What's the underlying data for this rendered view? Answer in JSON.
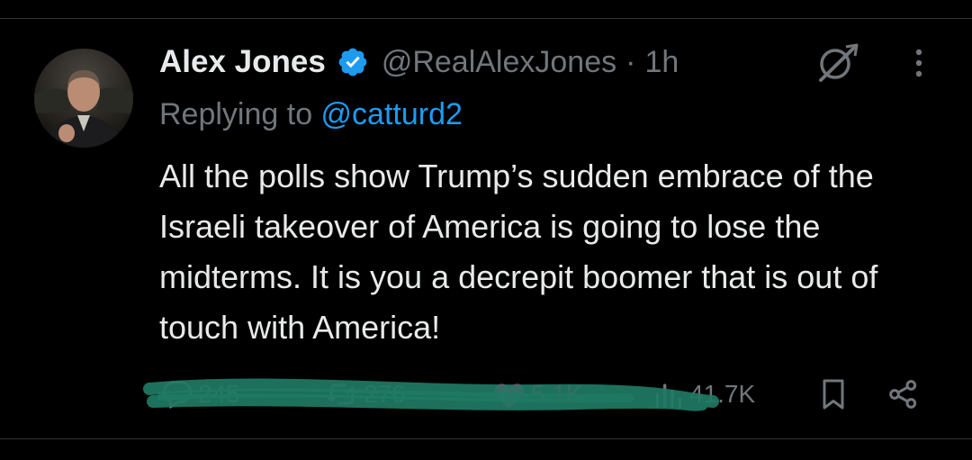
{
  "tweet": {
    "author": {
      "name": "Alex Jones",
      "handle": "@RealAlexJones",
      "verified_icon": "verified-badge-icon"
    },
    "separator": "·",
    "time": "1h",
    "replying_to_prefix": "Replying to ",
    "replying_to_handle": "@catturd2",
    "text": "All the polls show Trump’s sudden embrace of the Israeli takeover of America is going to lose the midterms. It is you a decrepit boomer that is out of touch with America!",
    "metrics": {
      "replies": "245",
      "reposts": "276",
      "likes": "5.1K",
      "views": "41.7K"
    }
  },
  "icons": {
    "reply": "speech-bubble-icon",
    "repost": "retweet-arrows-icon",
    "like": "heart-icon",
    "views": "bar-chart-icon",
    "bookmark": "bookmark-icon",
    "share": "share-icon",
    "grok": "grok-icon",
    "more": "vertical-ellipsis-icon"
  },
  "colors": {
    "background": "#000000",
    "text": "#e7e9ea",
    "muted": "#71767b",
    "link": "#1d9bf0",
    "like": "#f91880",
    "annotation_scribble": "#1f7a63"
  }
}
